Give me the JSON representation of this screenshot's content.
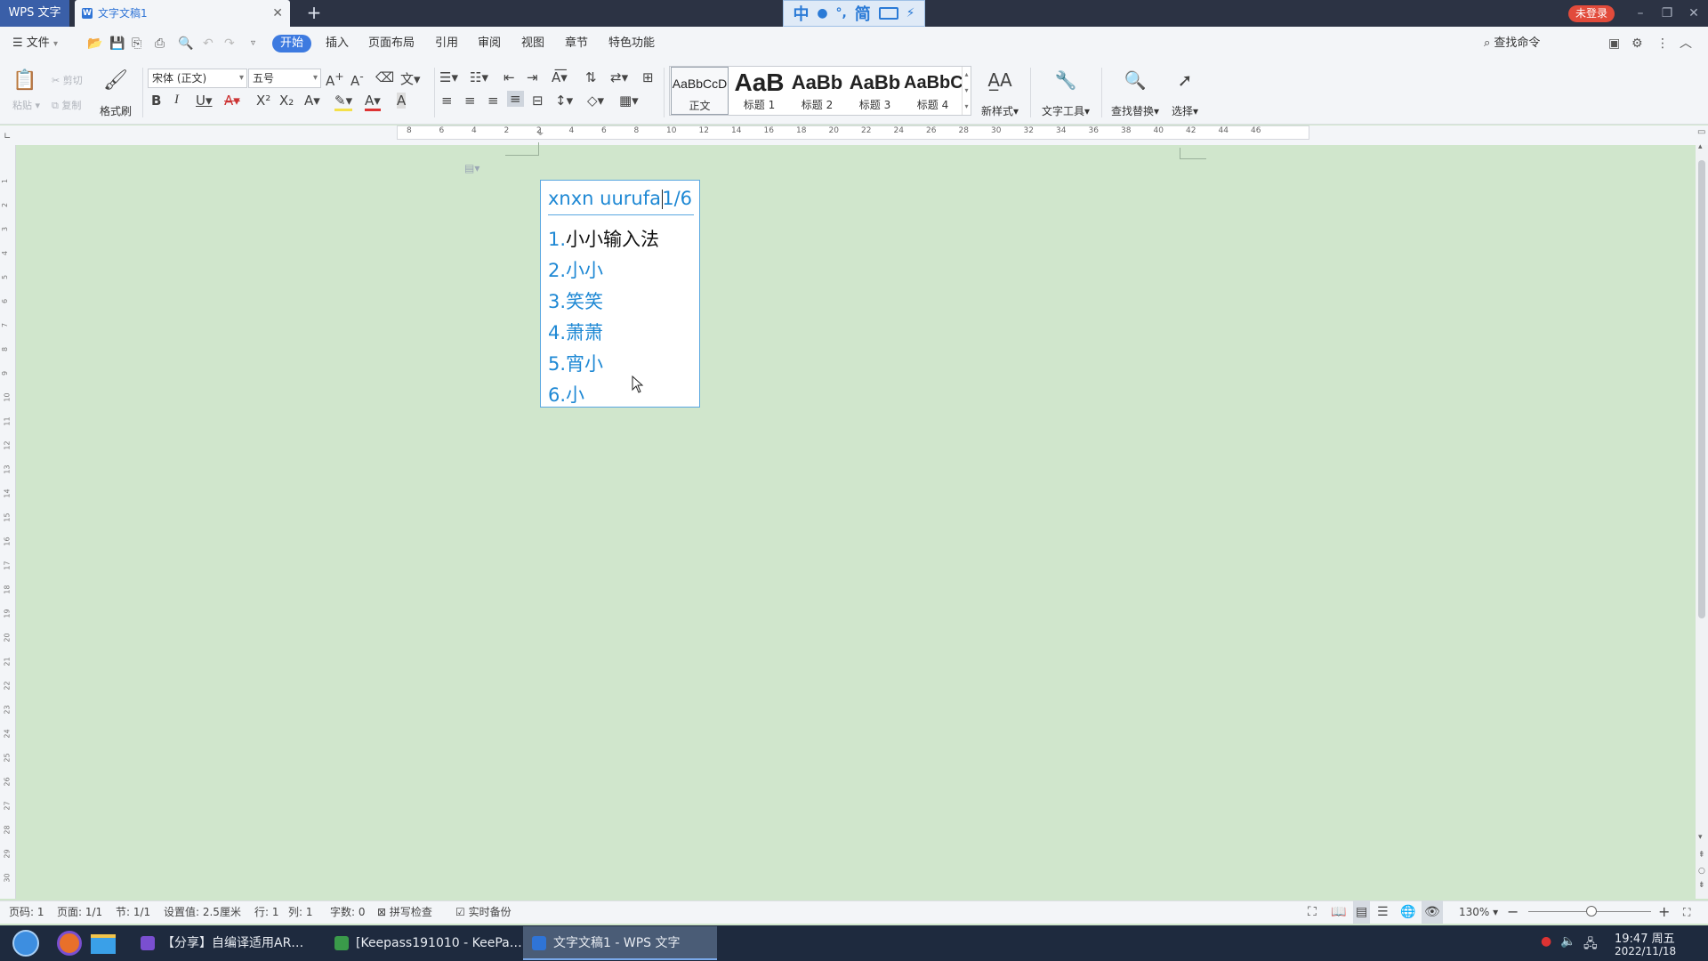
{
  "titlebar": {
    "app_name": "WPS 文字",
    "doc_tab": "文字文稿1",
    "login": "未登录"
  },
  "ime_toolbar": {
    "mode": "中",
    "punct": "°,",
    "charset": "简"
  },
  "menu": {
    "file": "文件",
    "tabs": [
      "开始",
      "插入",
      "页面布局",
      "引用",
      "审阅",
      "视图",
      "章节",
      "特色功能"
    ],
    "search_command": "查找命令"
  },
  "ribbon": {
    "paste": "粘贴",
    "cut": "剪切",
    "copy": "复制",
    "format_painter": "格式刷",
    "font_name": "宋体 (正文)",
    "font_size": "五号",
    "styles": [
      {
        "preview": "AaBbCcD",
        "label": "正文"
      },
      {
        "preview": "AaB",
        "label": "标题 1"
      },
      {
        "preview": "AaBb",
        "label": "标题 2"
      },
      {
        "preview": "AaBb",
        "label": "标题 3"
      },
      {
        "preview": "AaBbC",
        "label": "标题 4"
      }
    ],
    "new_style": "新样式",
    "text_tools": "文字工具",
    "find_replace": "查找替换",
    "select": "选择"
  },
  "ruler": {
    "ticks": [
      "8",
      "6",
      "4",
      "2",
      "2",
      "4",
      "6",
      "8",
      "10",
      "12",
      "14",
      "16",
      "18",
      "20",
      "22",
      "24",
      "26",
      "28",
      "30",
      "32",
      "34",
      "36",
      "38",
      "40",
      "42",
      "44",
      "46"
    ],
    "vticks": [
      "1",
      "2",
      "3",
      "4",
      "5",
      "6",
      "7",
      "8",
      "9",
      "10",
      "11",
      "12",
      "13",
      "14",
      "15",
      "16",
      "17",
      "18",
      "19",
      "20",
      "21",
      "22",
      "23",
      "24",
      "25",
      "26",
      "27",
      "28",
      "29",
      "30"
    ]
  },
  "ime_popup": {
    "composition": "xnxn uurufa",
    "page": "1/6",
    "candidates": [
      {
        "index": "1.",
        "word": "小小输入法"
      },
      {
        "index": "2.",
        "word": "小小"
      },
      {
        "index": "3.",
        "word": "笑笑"
      },
      {
        "index": "4.",
        "word": "萧萧"
      },
      {
        "index": "5.",
        "word": "宵小"
      },
      {
        "index": "6.",
        "word": "小"
      }
    ]
  },
  "statusbar": {
    "page_code": "页码: 1",
    "pages": "页面: 1/1",
    "section": "节: 1/1",
    "setting": "设置值: 2.5厘米",
    "row": "行: 1",
    "col": "列: 1",
    "word_count": "字数: 0",
    "spell_check": "拼写检查",
    "backup": "实时备份",
    "zoom": "130%"
  },
  "taskbar": {
    "tasks": [
      {
        "label": "【分享】自编译适用AR…",
        "active": false
      },
      {
        "label": "[Keepass191010 - KeePa…",
        "active": false
      },
      {
        "label": "文字文稿1 - WPS 文字",
        "active": true
      }
    ],
    "time": "19:47 周五",
    "date": "2022/11/18"
  },
  "colors": {
    "doc_background": "#d0e6cc",
    "accent": "#3d7ae0",
    "ime_text": "#1e88d4",
    "login_button": "#e24b3b"
  }
}
